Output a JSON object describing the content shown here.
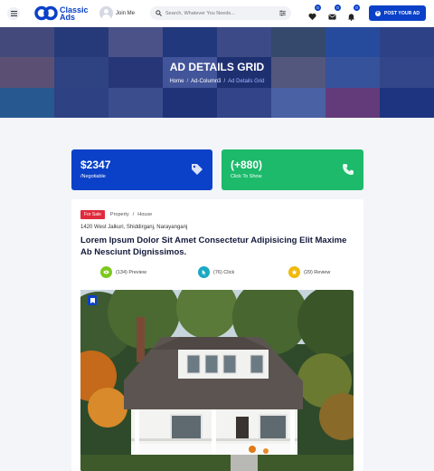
{
  "header": {
    "logo_text": "Classic Ads",
    "join_label": "Join Me",
    "search_placeholder": "Search, Whatever You Needs...",
    "favorites_count": "0",
    "messages_count": "0",
    "notifications_count": "0",
    "post_button_label": "POST YOUR AD",
    "brand_color": "#0a41c8"
  },
  "hero": {
    "title": "AD DETAILS GRID",
    "breadcrumb": [
      "Home",
      "Ad-Column3",
      "Ad Details Grid"
    ]
  },
  "price_card": {
    "value": "$2347",
    "note": "/Negotiable",
    "color": "#0a41c8"
  },
  "phone_card": {
    "value": "(+880)",
    "note": "Click To Show",
    "color": "#1cba6a"
  },
  "ad": {
    "badge": "For Sale",
    "category": [
      "Property",
      "House"
    ],
    "address": "1420 West Jalkuri, Shiddirganj, Narayanganj",
    "title": "Lorem Ipsum Dolor Sit Amet Consectetur Adipisicing Elit Maxime Ab Nesciunt Dignissimos.",
    "stats": {
      "preview": "(134) Preview",
      "click": "(76) Click",
      "review": "(29) Review"
    }
  }
}
